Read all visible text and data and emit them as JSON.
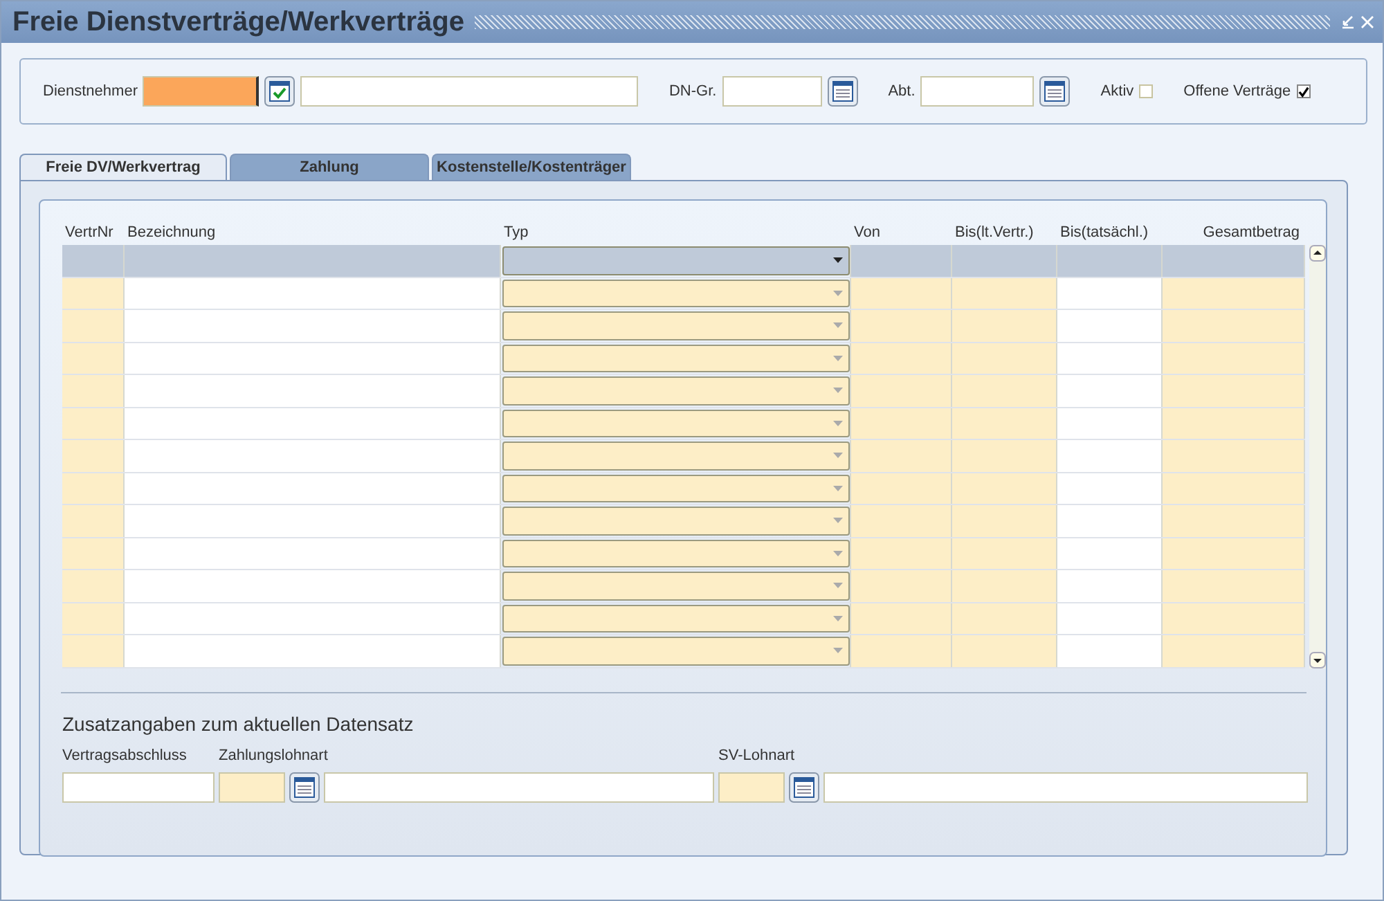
{
  "window": {
    "title": "Freie Dienstverträge/Werkverträge"
  },
  "filter": {
    "employee_label": "Dienstnehmer",
    "group_label": "DN-Gr.",
    "department_label": "Abt.",
    "checkboxes": [
      {
        "label": "Aktiv",
        "checked": false
      },
      {
        "label": "Offene Verträge",
        "checked": true
      }
    ]
  },
  "tabs": [
    {
      "label": "Freie DV/Werkvertrag",
      "selected": true
    },
    {
      "label": "Zahlung",
      "selected": false
    },
    {
      "label": "Kostenstelle/Kostenträger",
      "selected": false
    }
  ],
  "table": {
    "columns": [
      "VertrNr",
      "Bezeichnung",
      "Typ",
      "Von",
      "Bis(lt.Vertr.)",
      "Bis(tatsächl.)",
      "Gesamtbetrag"
    ],
    "rows": [
      {
        "selected": true
      },
      {
        "selected": false
      },
      {
        "selected": false
      },
      {
        "selected": false
      },
      {
        "selected": false
      },
      {
        "selected": false
      },
      {
        "selected": false
      },
      {
        "selected": false
      },
      {
        "selected": false
      },
      {
        "selected": false
      },
      {
        "selected": false
      },
      {
        "selected": false
      },
      {
        "selected": false
      }
    ]
  },
  "details": {
    "heading": "Zusatzangaben zum aktuellen Datensatz",
    "labels": [
      "Vertragsabschluss",
      "Zahlungslohnart",
      "SV-Lohnart"
    ]
  }
}
